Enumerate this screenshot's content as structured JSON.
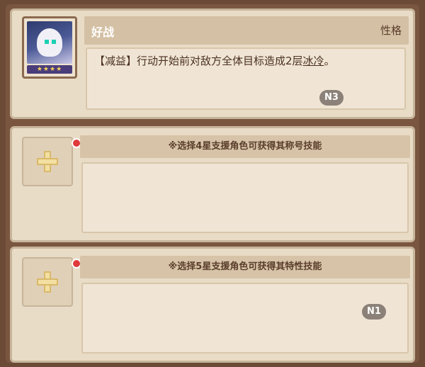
{
  "top_panel": {
    "stars": "★★★★",
    "trait_name": "好战",
    "trait_type": "性格",
    "description_prefix": "【减益】行动开始前对敌方全体目标造成2层",
    "description_link": "冰冷",
    "description_suffix": "。",
    "badge": "N3"
  },
  "support_slot_1": {
    "hint": "※选择4星支援角色可获得其称号技能"
  },
  "support_slot_2": {
    "hint": "※选择5星支援角色可获得其特性技能",
    "badge": "N1"
  }
}
